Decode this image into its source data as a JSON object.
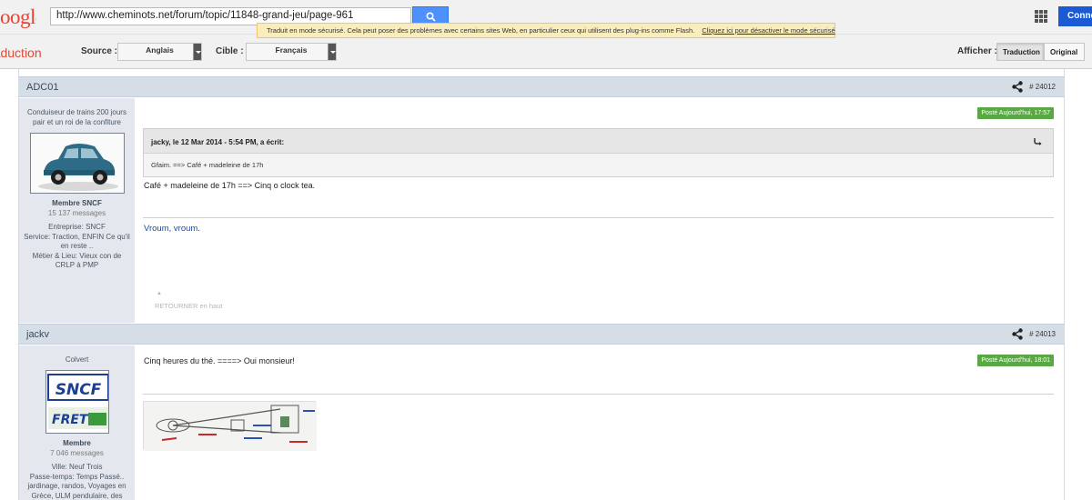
{
  "browser": {
    "logo_text": "oogle",
    "url": "http://www.cheminots.net/forum/topic/11848-grand-jeu/page-961",
    "connect_label": "Connexion"
  },
  "notice": {
    "text": "Traduit en mode sécurisé. Cela peut poser des problèmes avec certains sites Web, en particulier ceux qui utilisent des plug-ins comme Flash.",
    "link": "Cliquez ici pour désactiver le mode sécurisé"
  },
  "translate": {
    "title": "Traduction",
    "source_label": "Source :",
    "source_value": "Anglais",
    "target_label": "Cible :",
    "target_value": "Français",
    "show_label": "Afficher :",
    "btn_translation": "Traduction",
    "btn_original": "Original"
  },
  "posts": [
    {
      "author": "ADC01",
      "post_number": "# 24012",
      "user_title": "Conduiseur de trains 200 jours pair et un roi de la confiture",
      "role": "Membre SNCF",
      "message_count": "15 137 messages",
      "info_lines": [
        "Entreprise: SNCF",
        "Service: Traction, ENFIN Ce qu'il en reste ..",
        "Métier & Lieu: Vieux con de CRLP à PMP"
      ],
      "posted": "Posté Aujourd'hui, 17:57",
      "quote_header": "jacky, le 12 Mar 2014 - 5:54 PM, a écrit:",
      "quote_body": "Gfaim. ==> Café + madeleine de 17h",
      "body": "Café + madeleine de 17h ==> Cinq o clock tea.",
      "signature": "Vroum, vroum.",
      "back_to_top": "RETOURNER en haut"
    },
    {
      "author": "jackv",
      "post_number": "# 24013",
      "user_title": "Colvert",
      "role": "Membre",
      "message_count": "7 046 messages",
      "info_lines": [
        "Ville: Neuf Trois",
        "Passe-temps: Temps Passé.. jardinage, randos, Voyages en Grèce, ULM pendulaire, des photos en"
      ],
      "posted": "Posté Aujourd'hui, 18:01",
      "body": "Cinq heures du thé. ====> Oui monsieur!",
      "avatar_logo_top": "SNCF",
      "avatar_logo_bottom": "FRET"
    }
  ],
  "colors": {
    "header_bg": "#d5dde6",
    "user_panel_bg": "#e4e8ee",
    "badge_green": "#5aa844",
    "signature_blue": "#1b4aa5",
    "translate_red": "#dd4b39"
  },
  "icons": [
    "search-icon",
    "apps-icon",
    "dropdown-arrow-icon",
    "share-icon",
    "reply-icon",
    "up-arrow-icon"
  ]
}
